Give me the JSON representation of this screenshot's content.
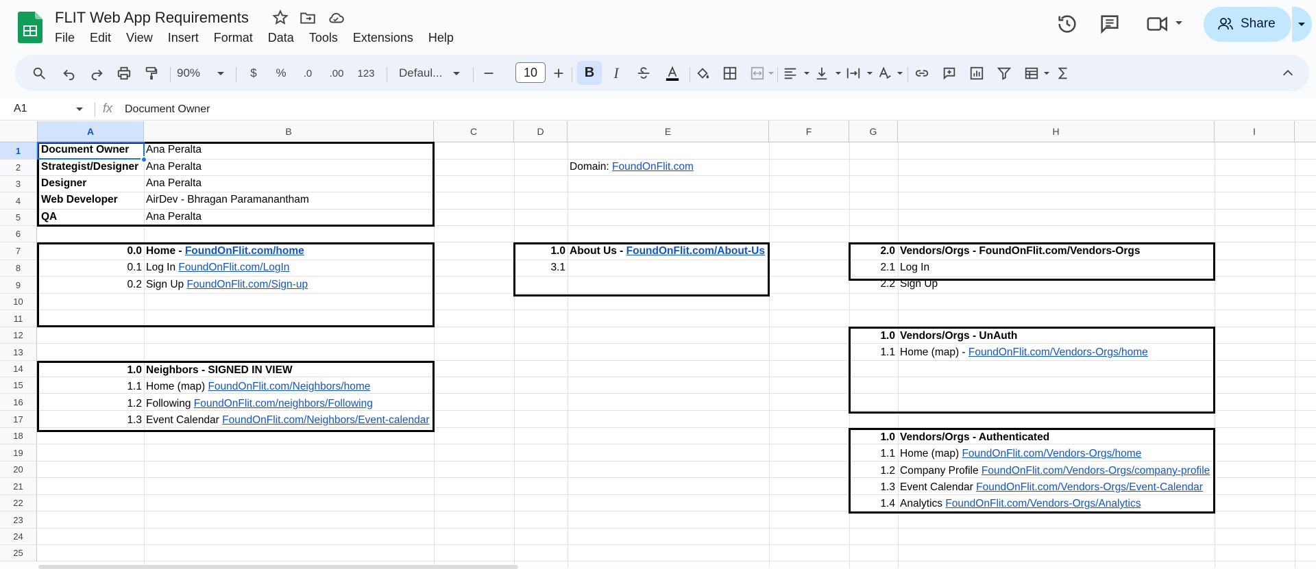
{
  "app": {
    "title": "FLIT Web App Requirements",
    "menu": [
      "File",
      "Edit",
      "View",
      "Insert",
      "Format",
      "Data",
      "Tools",
      "Extensions",
      "Help"
    ],
    "share_label": "Share"
  },
  "toolbar": {
    "zoom": "90%",
    "currency": "$",
    "percent": "%",
    "dec_decrease": ".0",
    "dec_increase": ".00",
    "number_format": "123",
    "font": "Defaul...",
    "font_size": "10",
    "bold": "B",
    "italic": "I"
  },
  "formula_bar": {
    "name_box": "A1",
    "fx": "fx",
    "value": "Document Owner"
  },
  "columns": [
    "A",
    "B",
    "C",
    "D",
    "E",
    "F",
    "G",
    "H",
    "I"
  ],
  "rows": [
    "1",
    "2",
    "3",
    "4",
    "5",
    "6",
    "7",
    "8",
    "9",
    "10",
    "11",
    "12",
    "13",
    "14",
    "15",
    "16",
    "17",
    "18",
    "19",
    "20",
    "21",
    "22",
    "23",
    "24",
    "25"
  ],
  "cells": {
    "A1": "Document Owner",
    "B1": "Ana Peralta",
    "A2": "Strategist/Designer",
    "B2": "Ana Peralta",
    "A3": "Designer",
    "B3": "Ana Peralta",
    "A4": "Web Developer",
    "B4": "AirDev - Bhragan Paramanantham",
    "A5": "QA",
    "B5": "Ana Peralta",
    "E2_label": "Domain: ",
    "E2_link": "FoundOnFlit.com",
    "A7": "0.0",
    "B7_label": "Home - ",
    "B7_link": "FoundOnFlit.com/home",
    "A8": "0.1",
    "B8_label": "Log In ",
    "B8_link": "FoundOnFlit.com/LogIn",
    "A9": "0.2",
    "B9_label": "Sign Up ",
    "B9_link": "FoundOnFlit.com/Sign-up",
    "D7": "1.0",
    "E7_label": "About Us - ",
    "E7_link": "FoundOnFlit.com/About-Us",
    "D8": "3.1",
    "G7": "2.0",
    "H7": "Vendors/Orgs - FoundOnFlit.com/Vendors-Orgs",
    "G8": "2.1",
    "H8": "Log In",
    "G9": "2.2",
    "H9": "Sign Up",
    "G12": "1.0",
    "H12": "Vendors/Orgs - UnAuth",
    "G13": "1.1",
    "H13_label": "Home (map) - ",
    "H13_link": "FoundOnFlit.com/Vendors-Orgs/home",
    "A14": "1.0",
    "B14": "Neighbors - SIGNED IN VIEW",
    "A15": "1.1",
    "B15_label": "Home (map) ",
    "B15_link": "FoundOnFlit.com/Neighbors/home",
    "A16": "1.2",
    "B16_label": "Following ",
    "B16_link": "FoundOnFlit.com/neighbors/Following",
    "A17": "1.3",
    "B17_label": "Event Calendar ",
    "B17_link": "FoundOnFlit.com/Neighbors/Event-calendar",
    "G18": "1.0",
    "H18": "Vendors/Orgs - Authenticated",
    "G19": "1.1",
    "H19_label": "Home (map) ",
    "H19_link": "FoundOnFlit.com/Vendors-Orgs/home",
    "G20": "1.2",
    "H20_label": "Company Profile ",
    "H20_link": "FoundOnFlit.com/Vendors-Orgs/company-profile",
    "G21": "1.3",
    "H21_label": "Event Calendar ",
    "H21_link": "FoundOnFlit.com/Vendors-Orgs/Event-Calendar",
    "G22": "1.4",
    "H22_label": "Analytics ",
    "H22_link": "FoundOnFlit.com/Vendors-Orgs/Analytics"
  }
}
